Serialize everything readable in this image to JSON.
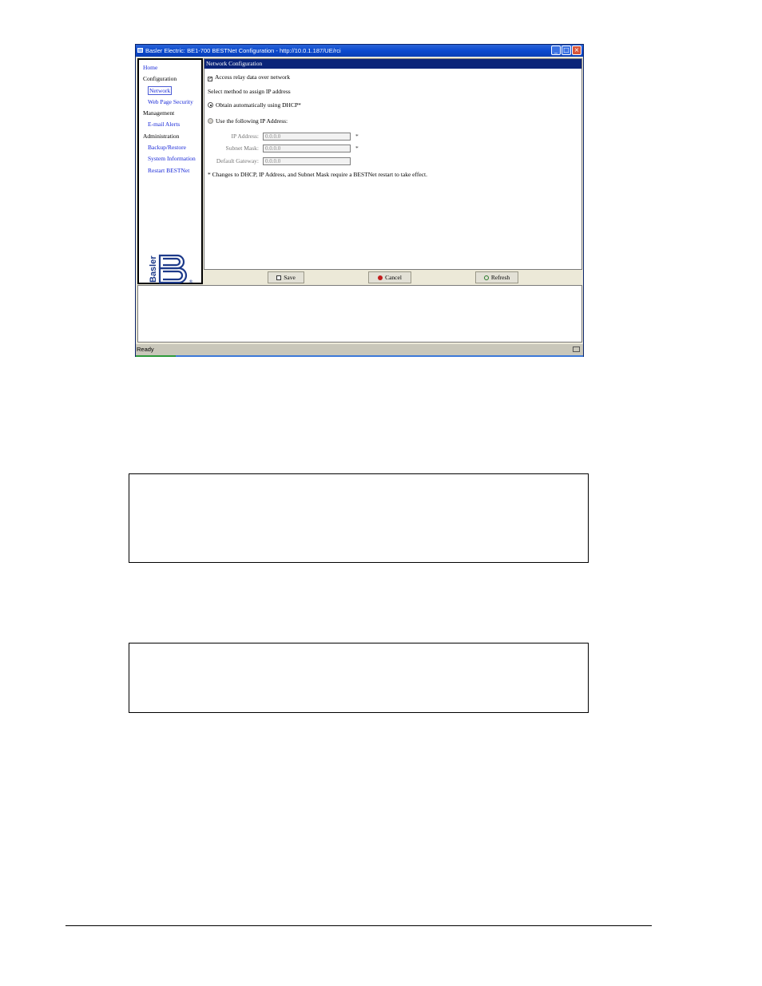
{
  "window": {
    "title": "Basler Electric: BE1-700 BESTNet Configuration - http://10.0.1.187/UE/rci",
    "controls": [
      "_",
      "□",
      "×"
    ]
  },
  "nav": {
    "home": "Home",
    "configuration": "Configuration",
    "network": "Network",
    "web_page_security": "Web Page Security",
    "management": "Management",
    "email_alerts": "E-mail Alerts",
    "administration": "Administration",
    "backup_restore": "Backup/Restore",
    "system_information": "System Information",
    "restart_bestnet": "Restart BESTNet"
  },
  "logo": {
    "text": "Basler",
    "letter": "B",
    "mark": "®"
  },
  "panel": {
    "header": "Network Configuration",
    "access_checkbox_label": "Access relay data over network",
    "access_checked": true,
    "select_method": "Select method to assign IP address",
    "dhcp_label": "Obtain automatically using DHCP*",
    "static_label": "Use the following IP Address:",
    "selected_method": "dhcp",
    "ip_label": "IP Address:",
    "ip_value": "0.0.0.0",
    "subnet_label": "Subnet Mask:",
    "subnet_value": "0.0.0.0",
    "gateway_label": "Default Gateway:",
    "gateway_value": "0.0.0.0",
    "required_mark": "*",
    "note": "* Changes to DHCP, IP Address, and Subnet Mask require a BESTNet restart to take effect."
  },
  "buttons": {
    "save": "Save",
    "cancel": "Cancel",
    "refresh": "Refresh"
  },
  "status": {
    "text": "Ready"
  }
}
